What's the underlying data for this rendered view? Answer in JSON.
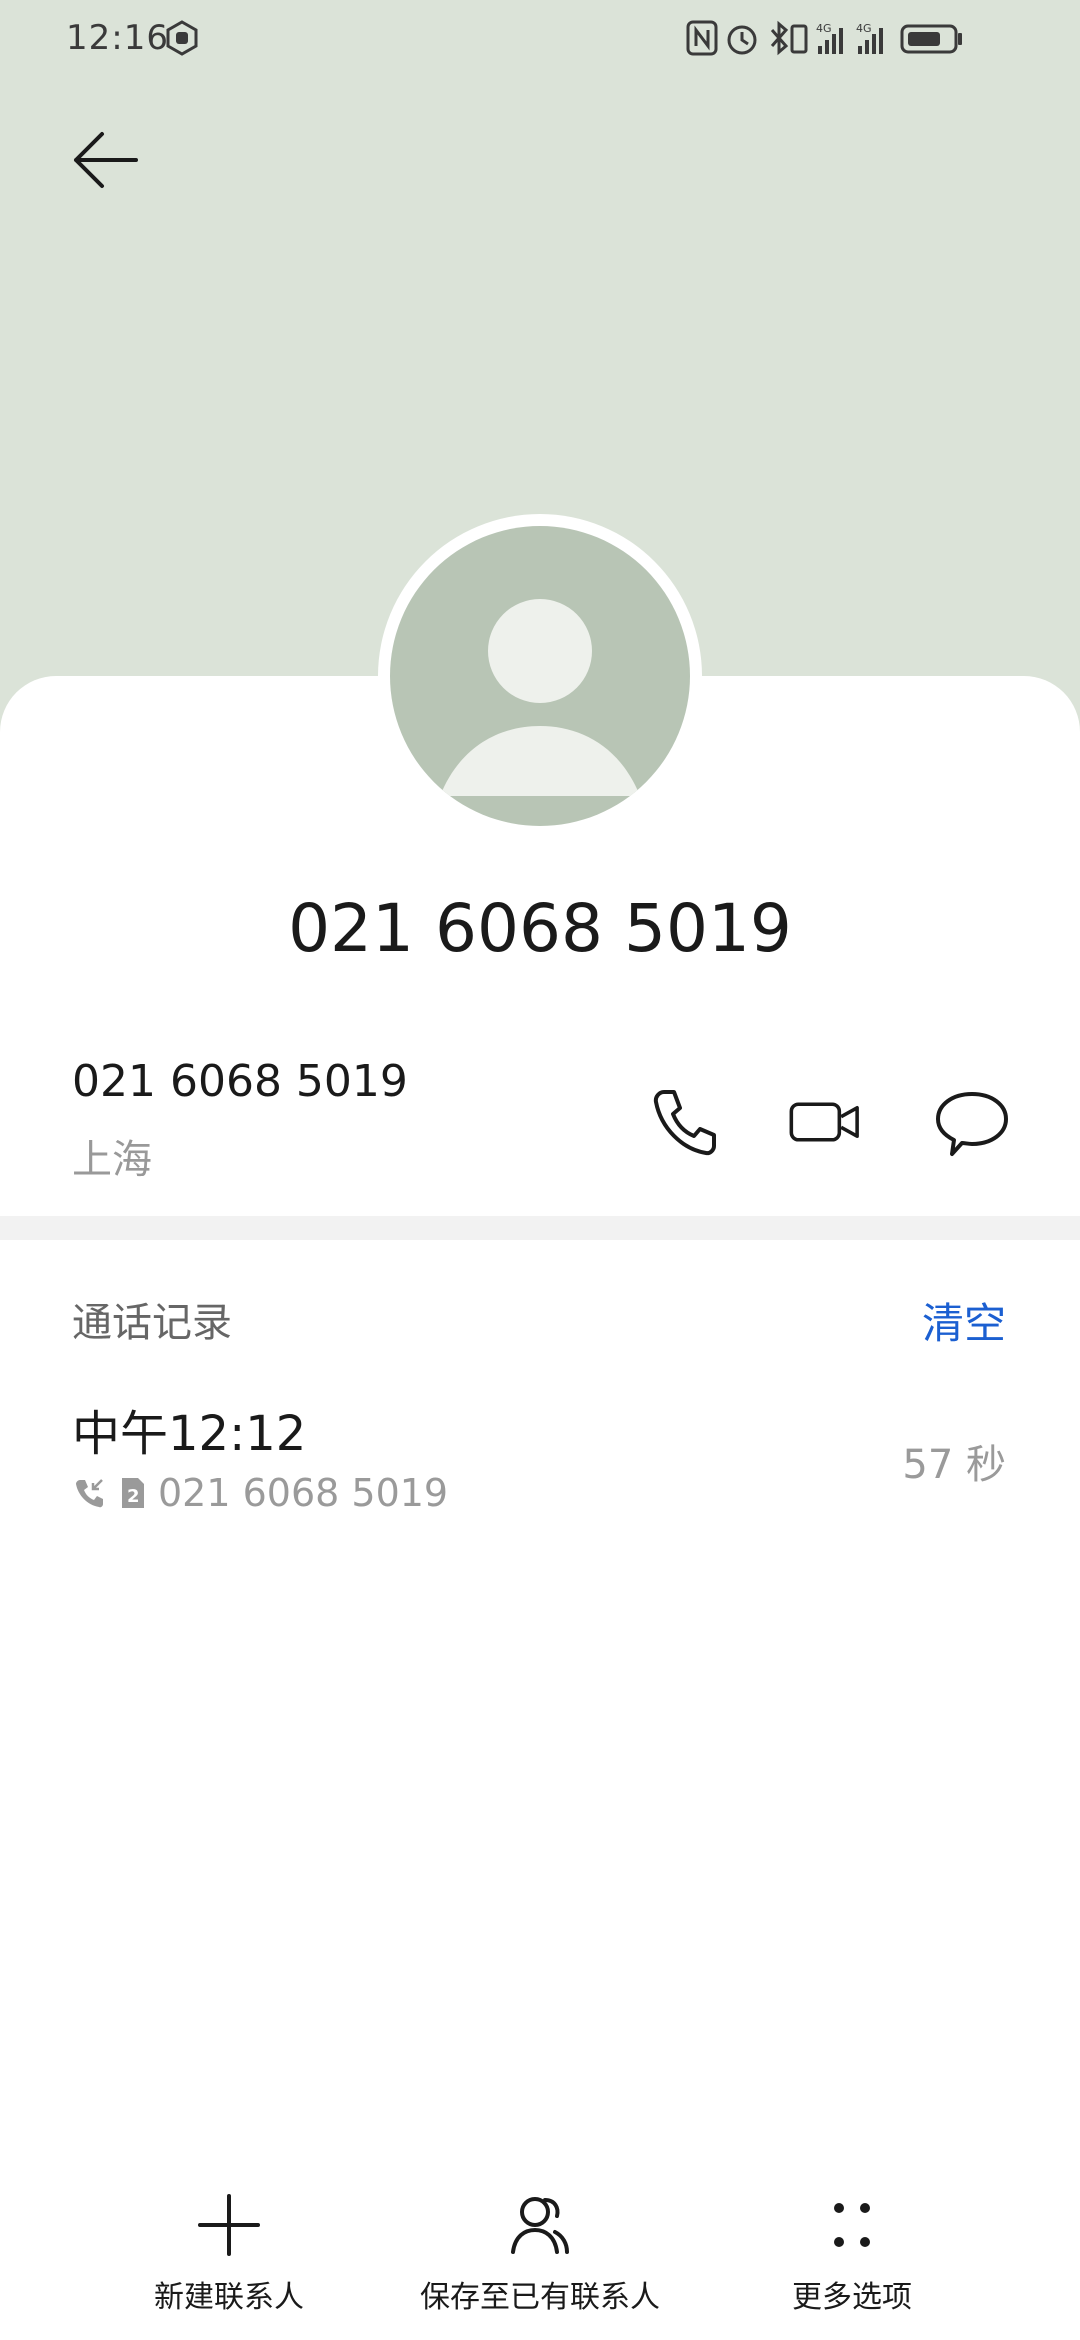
{
  "status_bar": {
    "time": "12:16",
    "network_1": "4G",
    "network_2": "4G"
  },
  "header": {
    "back_icon": "arrow-left-icon",
    "background_color": "#dbe3d8"
  },
  "contact": {
    "display_name": "021 6068 5019",
    "avatar_icon": "person-placeholder-icon",
    "phone_number": "021 6068 5019",
    "location": "上海",
    "actions": [
      {
        "icon": "phone-icon"
      },
      {
        "icon": "video-call-icon"
      },
      {
        "icon": "message-icon"
      }
    ]
  },
  "call_log": {
    "title": "通话记录",
    "clear_label": "清空",
    "accent_color": "#1b5fd1",
    "entries": [
      {
        "time": "中午12:12",
        "type_icon": "incoming-call-icon",
        "sim_icon": "sim-2-icon",
        "number": "021 6068 5019",
        "duration": "57 秒"
      }
    ]
  },
  "bottom_bar": {
    "items": [
      {
        "label": "新建联系人",
        "icon": "plus-icon"
      },
      {
        "label": "保存至已有联系人",
        "icon": "person-add-icon"
      },
      {
        "label": "更多选项",
        "icon": "more-dots-icon"
      }
    ]
  }
}
